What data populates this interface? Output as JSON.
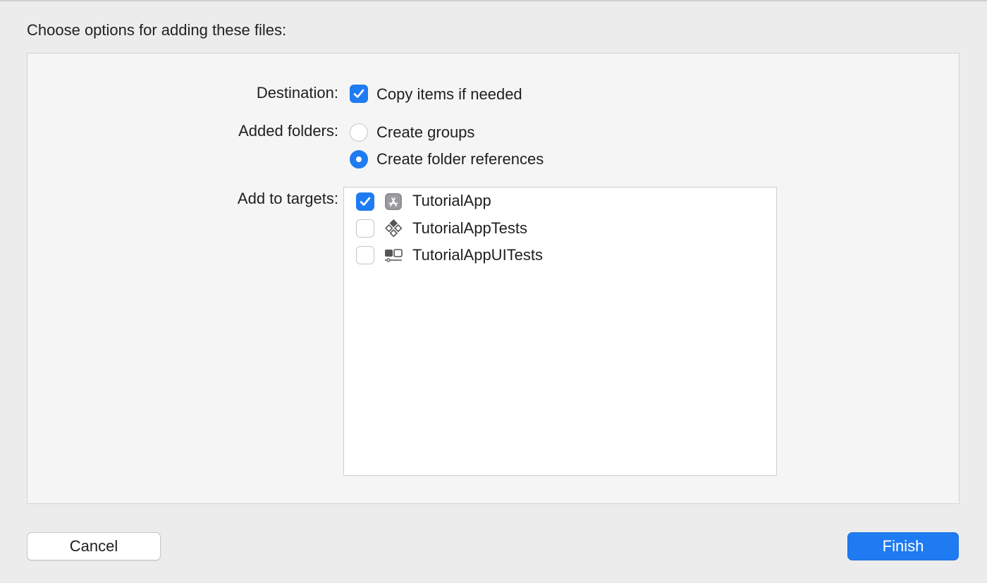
{
  "dialog": {
    "title": "Choose options for adding these files:"
  },
  "destination": {
    "label": "Destination:",
    "copy_items": {
      "label": "Copy items if needed",
      "checked": true
    }
  },
  "added_folders": {
    "label": "Added folders:",
    "options": [
      {
        "label": "Create groups",
        "selected": false
      },
      {
        "label": "Create folder references",
        "selected": true
      }
    ]
  },
  "targets": {
    "label": "Add to targets:",
    "items": [
      {
        "name": "TutorialApp",
        "checked": true,
        "icon": "app-store-icon"
      },
      {
        "name": "TutorialAppTests",
        "checked": false,
        "icon": "unit-test-icon"
      },
      {
        "name": "TutorialAppUITests",
        "checked": false,
        "icon": "ui-test-icon"
      }
    ]
  },
  "buttons": {
    "cancel": "Cancel",
    "finish": "Finish"
  },
  "colors": {
    "accent": "#1f7bf2"
  }
}
